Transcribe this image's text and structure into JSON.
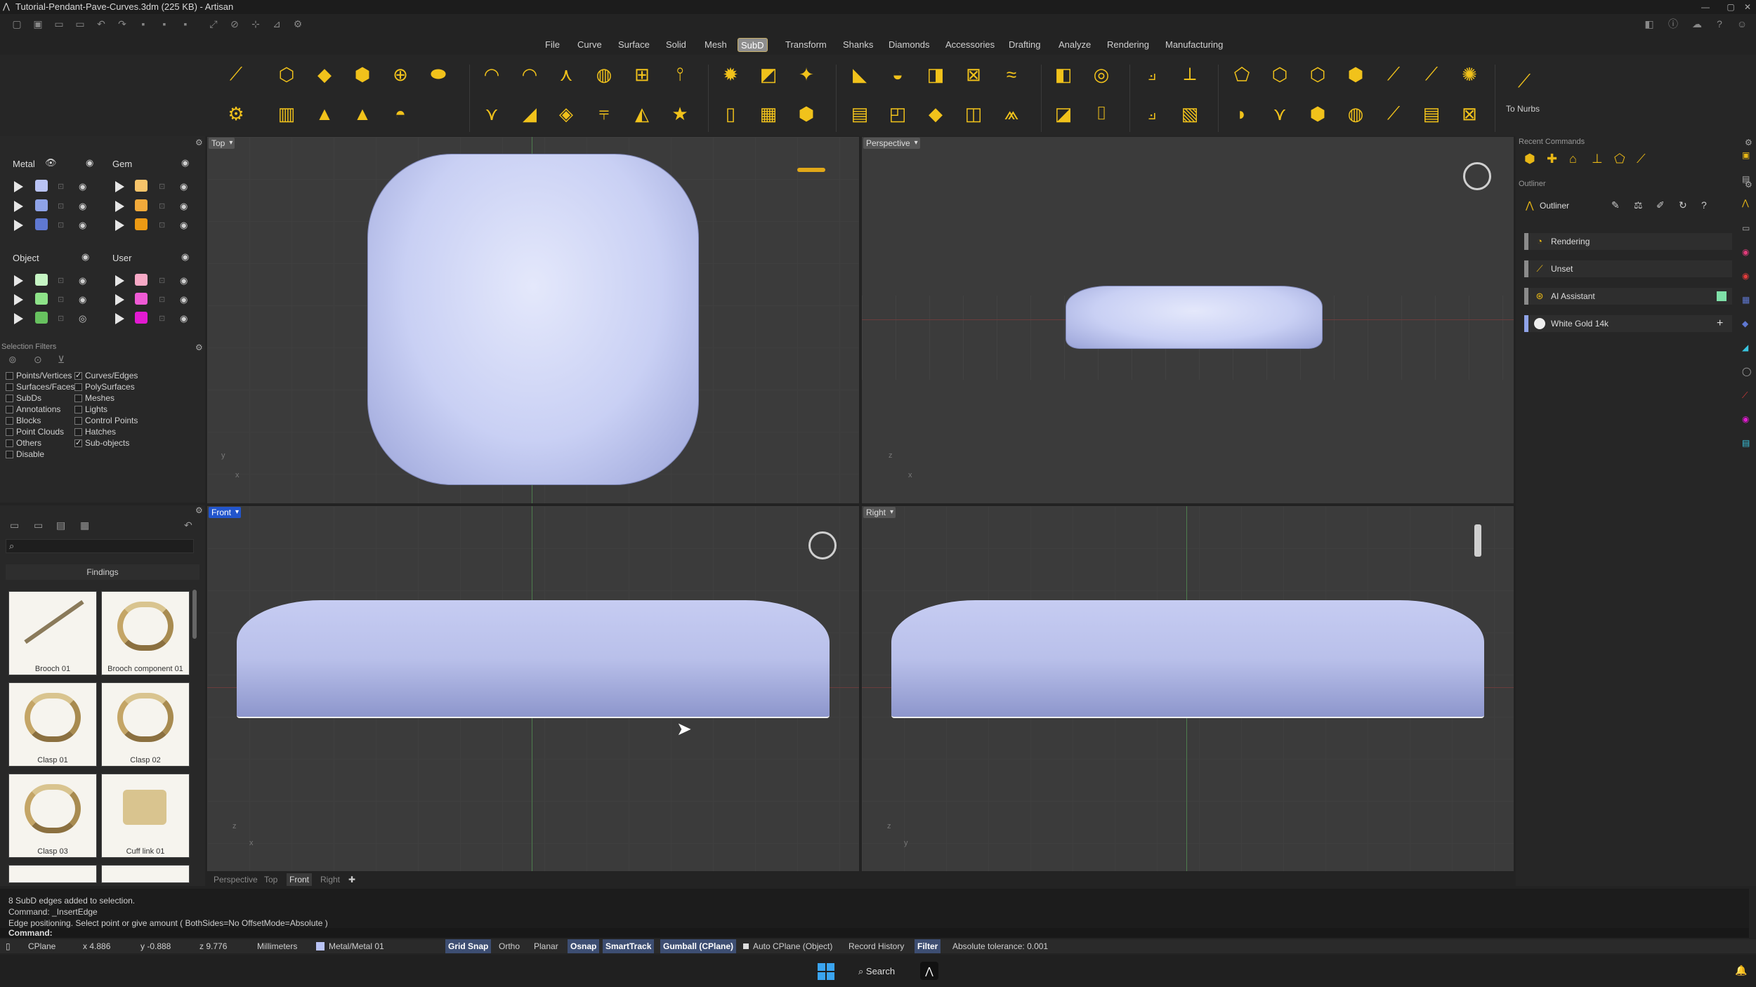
{
  "window": {
    "title": "Tutorial-Pendant-Pave-Curves.3dm (225 KB) - Artisan",
    "logo_icon": "artisan-logo-icon"
  },
  "menus": [
    "File",
    "Curve",
    "Surface",
    "Solid",
    "Mesh",
    "SubD",
    "Transform",
    "Shanks",
    "Diamonds",
    "Accessories",
    "Drafting",
    "Analyze",
    "Rendering",
    "Manufacturing"
  ],
  "active_menu": "SubD",
  "toolbar": {
    "to_nurbs_label": "To Nurbs"
  },
  "layers": {
    "metal_title": "Metal",
    "gem_title": "Gem",
    "object_title": "Object",
    "user_title": "User",
    "metal_colors": [
      "#b9c3f5",
      "#8fa3e8",
      "#5f78d2"
    ],
    "gem_colors": [
      "#f7c46a",
      "#f2aa3a",
      "#ec9a14"
    ],
    "object_colors": [
      "#c6f5c4",
      "#8ee389",
      "#67c15f"
    ],
    "user_colors": [
      "#f7a9c6",
      "#ef5ad5",
      "#e21ad1"
    ]
  },
  "selection_filters": {
    "title": "Selection Filters",
    "left": [
      {
        "label": "Points/Vertices",
        "checked": false
      },
      {
        "label": "Surfaces/Faces",
        "checked": false
      },
      {
        "label": "SubDs",
        "checked": false
      },
      {
        "label": "Annotations",
        "checked": false
      },
      {
        "label": "Blocks",
        "checked": false
      },
      {
        "label": "Point Clouds",
        "checked": false
      },
      {
        "label": "Others",
        "checked": false
      },
      {
        "label": "Disable",
        "checked": false
      }
    ],
    "right": [
      {
        "label": "Curves/Edges",
        "checked": true
      },
      {
        "label": "PolySurfaces",
        "checked": false
      },
      {
        "label": "Meshes",
        "checked": false
      },
      {
        "label": "Lights",
        "checked": false
      },
      {
        "label": "Control Points",
        "checked": false
      },
      {
        "label": "Hatches",
        "checked": false
      },
      {
        "label": "Sub-objects",
        "checked": true
      }
    ]
  },
  "library": {
    "category": "Findings",
    "items": [
      "Brooch 01",
      "Brooch component 01",
      "Clasp 01",
      "Clasp 02",
      "Clasp 03",
      "Cuff link 01"
    ]
  },
  "viewports": {
    "top": "Top",
    "perspective": "Perspective",
    "front": "Front",
    "right": "Right"
  },
  "viewport_tabs": [
    "Perspective",
    "Top",
    "Front",
    "Right"
  ],
  "active_viewport_tab": "Front",
  "recent_commands": {
    "title": "Recent Commands"
  },
  "outliner": {
    "title": "Outliner",
    "header": "Outliner",
    "items": [
      {
        "label": "Rendering",
        "icon": "palette-icon"
      },
      {
        "label": "Unset",
        "icon": "brush-icon"
      },
      {
        "label": "AI Assistant",
        "icon": "ai-assistant-icon"
      },
      {
        "label": "White Gold 14k",
        "icon": "material-sphere-icon"
      }
    ]
  },
  "command_history": [
    "8 SubD edges added to selection.",
    "Command: _InsertEdge",
    "Edge positioning. Select point or give amount ( BothSides=No  OffsetMode=Absolute )"
  ],
  "command_prompt": "Command:",
  "status": {
    "cplane": "CPlane",
    "x": "x 4.886",
    "y": "y -0.888",
    "z": "z 9.776",
    "units": "Millimeters",
    "layer": "Metal/Metal 01",
    "layer_color": "#b9c3f5",
    "grid_snap": "Grid Snap",
    "ortho": "Ortho",
    "planar": "Planar",
    "osnap": "Osnap",
    "smarttrack": "SmartTrack",
    "gumball": "Gumball (CPlane)",
    "auto_cplane": "Auto CPlane (Object)",
    "record_history": "Record History",
    "filter": "Filter",
    "tolerance": "Absolute tolerance: 0.001"
  },
  "taskbar": {
    "search": "Search"
  }
}
